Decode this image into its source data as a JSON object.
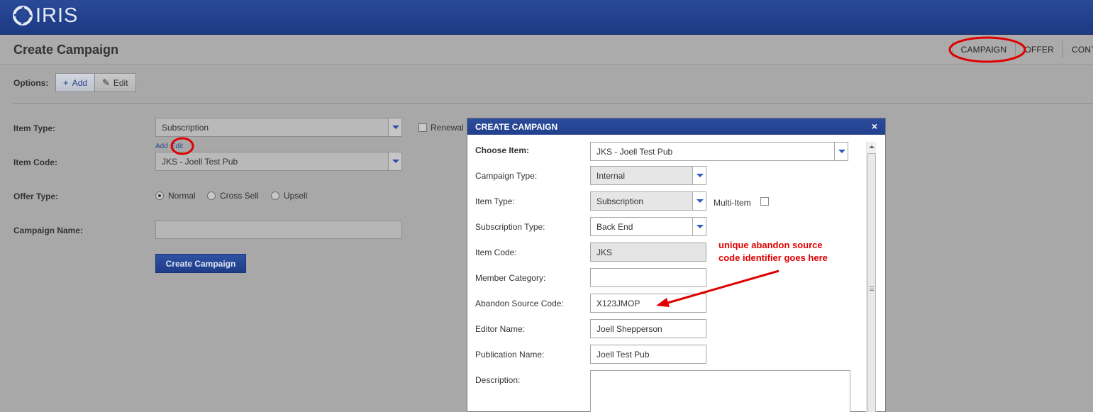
{
  "app": {
    "logo_text": "IRIS",
    "brand_color": "#213f8c"
  },
  "header": {
    "title": "Create Campaign"
  },
  "topnav": {
    "items": [
      "CAMPAIGN",
      "OFFER",
      "CONT"
    ]
  },
  "options": {
    "label": "Options:",
    "buttons": [
      {
        "label": "Add",
        "icon": "plus-icon"
      },
      {
        "label": "Edit",
        "icon": "pencil-icon"
      }
    ]
  },
  "form": {
    "item_type": {
      "label": "Item Type:",
      "value": "Subscription"
    },
    "renewal": {
      "label": "Renewal",
      "checked": false
    },
    "links": {
      "add": "Add",
      "edit": "Edit"
    },
    "item_code": {
      "label": "Item Code:",
      "value": "JKS - Joell Test Pub"
    },
    "offer_type": {
      "label": "Offer Type:",
      "options": [
        "Normal",
        "Cross Sell",
        "Upsell"
      ],
      "selected": "Normal"
    },
    "campaign_name": {
      "label": "Campaign Name:",
      "value": ""
    },
    "submit": "Create Campaign"
  },
  "modal": {
    "title": "CREATE CAMPAIGN",
    "close": "×",
    "choose_item": {
      "label": "Choose Item:",
      "value": "JKS - Joell Test Pub"
    },
    "campaign_type": {
      "label": "Campaign Type:",
      "value": "Internal"
    },
    "item_type": {
      "label": "Item Type:",
      "value": "Subscription"
    },
    "multi_item": {
      "label": "Multi-Item",
      "checked": false
    },
    "subscription_type": {
      "label": "Subscription Type:",
      "value": "Back End"
    },
    "item_code": {
      "label": "Item Code:",
      "value": "JKS"
    },
    "member_category": {
      "label": "Member Category:",
      "value": ""
    },
    "abandon_source_code": {
      "label": "Abandon Source Code:",
      "value": "X123JMOP"
    },
    "editor_name": {
      "label": "Editor Name:",
      "value": "Joell Shepperson"
    },
    "publication_name": {
      "label": "Publication Name:",
      "value": "Joell Test Pub"
    },
    "description": {
      "label": "Description:",
      "value": ""
    }
  },
  "annotation": {
    "line1": "unique abandon source",
    "line2": "code identifier goes here",
    "color": "#e00000"
  }
}
